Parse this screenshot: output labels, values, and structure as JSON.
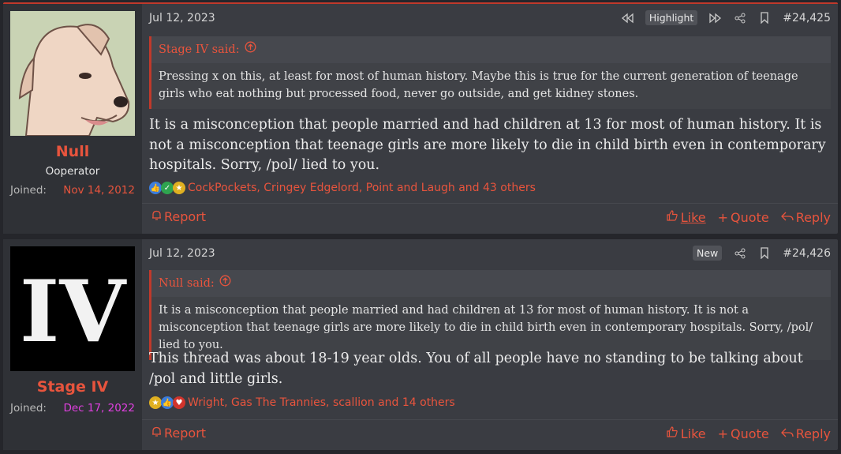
{
  "posts": [
    {
      "username": "Null",
      "usertitle": "Ooperator",
      "joined_label": "Joined:",
      "joined_date": "Nov 14, 2012",
      "joined_color": "#e8543d",
      "date": "Jul 12, 2023",
      "badge": "Highlight",
      "post_number": "#24,425",
      "quote_author": "Stage IV said:",
      "quote_text": "Pressing x on this, at least for most of human history. Maybe this is true for the current generation of teenage girls who eat nothing but processed food, never go outside, and get kidney stones.",
      "message": "It is a misconception that people married and had children at 13 for most of human history. It is not a misconception that teenage girls are more likely to die in child birth even in contemporary hospitals. Sorry, /pol/ lied to you.",
      "reactions_text": "CockPockets, Cringey Edgelord, Point and Laugh and 43 others",
      "report_label": "Report",
      "like_label": "Like",
      "quote_label": "Quote",
      "reply_label": "Reply"
    },
    {
      "username": "Stage IV",
      "usertitle": "",
      "joined_label": "Joined:",
      "joined_date": "Dec 17, 2022",
      "joined_color": "#e040e0",
      "date": "Jul 12, 2023",
      "badge": "New",
      "post_number": "#24,426",
      "avatar_text": "IV",
      "quote_author": "Null said:",
      "quote_text": "It is a misconception that people married and had children at 13 for most of human history. It is not a misconception that teenage girls are more likely to die in child birth even in contemporary hospitals. Sorry, /pol/ lied to you.",
      "message": "This thread was about 18-19 year olds. You of all people have no standing to be talking about /pol and little girls.",
      "reactions_text": "Wright, Gas The Trannies, scallion and 14 others",
      "report_label": "Report",
      "like_label": "Like",
      "quote_label": "Quote",
      "reply_label": "Reply"
    }
  ],
  "colors": {
    "accent": "#e8543d",
    "bg": "#3a3c42"
  }
}
